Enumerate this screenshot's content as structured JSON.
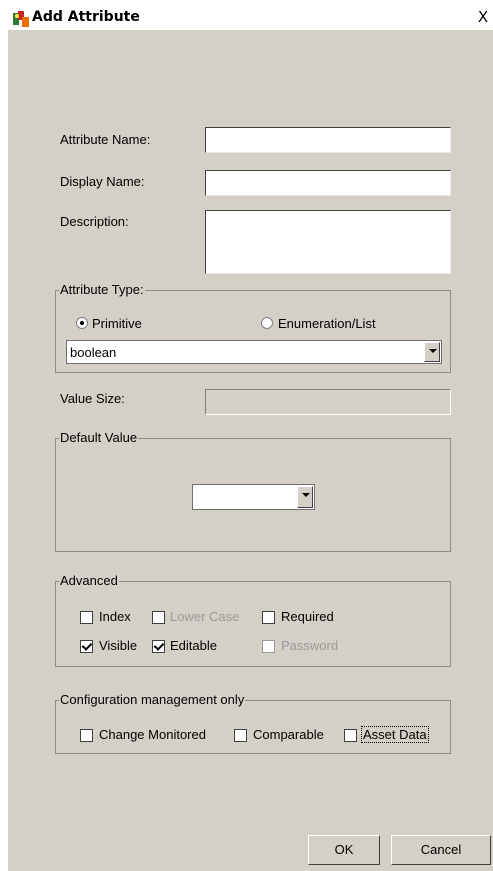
{
  "window": {
    "title": "Add Attribute",
    "close_glyph": "X"
  },
  "fields": {
    "attribute_name_label": "Attribute Name:",
    "attribute_name_value": "",
    "display_name_label": "Display Name:",
    "display_name_value": "",
    "description_label": "Description:",
    "description_value": "",
    "value_size_label": "Value Size:",
    "value_size_value": ""
  },
  "attribute_type": {
    "title": "Attribute Type:",
    "primitive_label": "Primitive",
    "enumeration_label": "Enumeration/List",
    "selected": "Primitive",
    "type_value": "boolean"
  },
  "default_value": {
    "title": "Default Value",
    "selected": ""
  },
  "advanced": {
    "title": "Advanced",
    "index_label": "Index",
    "index_checked": false,
    "lower_case_label": "Lower Case",
    "lower_case_checked": false,
    "required_label": "Required",
    "required_checked": false,
    "visible_label": "Visible",
    "visible_checked": true,
    "editable_label": "Editable",
    "editable_checked": true,
    "password_label": "Password",
    "password_checked": false
  },
  "config_mgmt": {
    "title": "Configuration management only",
    "change_monitored_label": "Change Monitored",
    "change_monitored_checked": false,
    "comparable_label": "Comparable",
    "comparable_checked": false,
    "asset_data_label": "Asset Data",
    "asset_data_checked": false
  },
  "buttons": {
    "ok_label": "OK",
    "cancel_label": "Cancel"
  }
}
